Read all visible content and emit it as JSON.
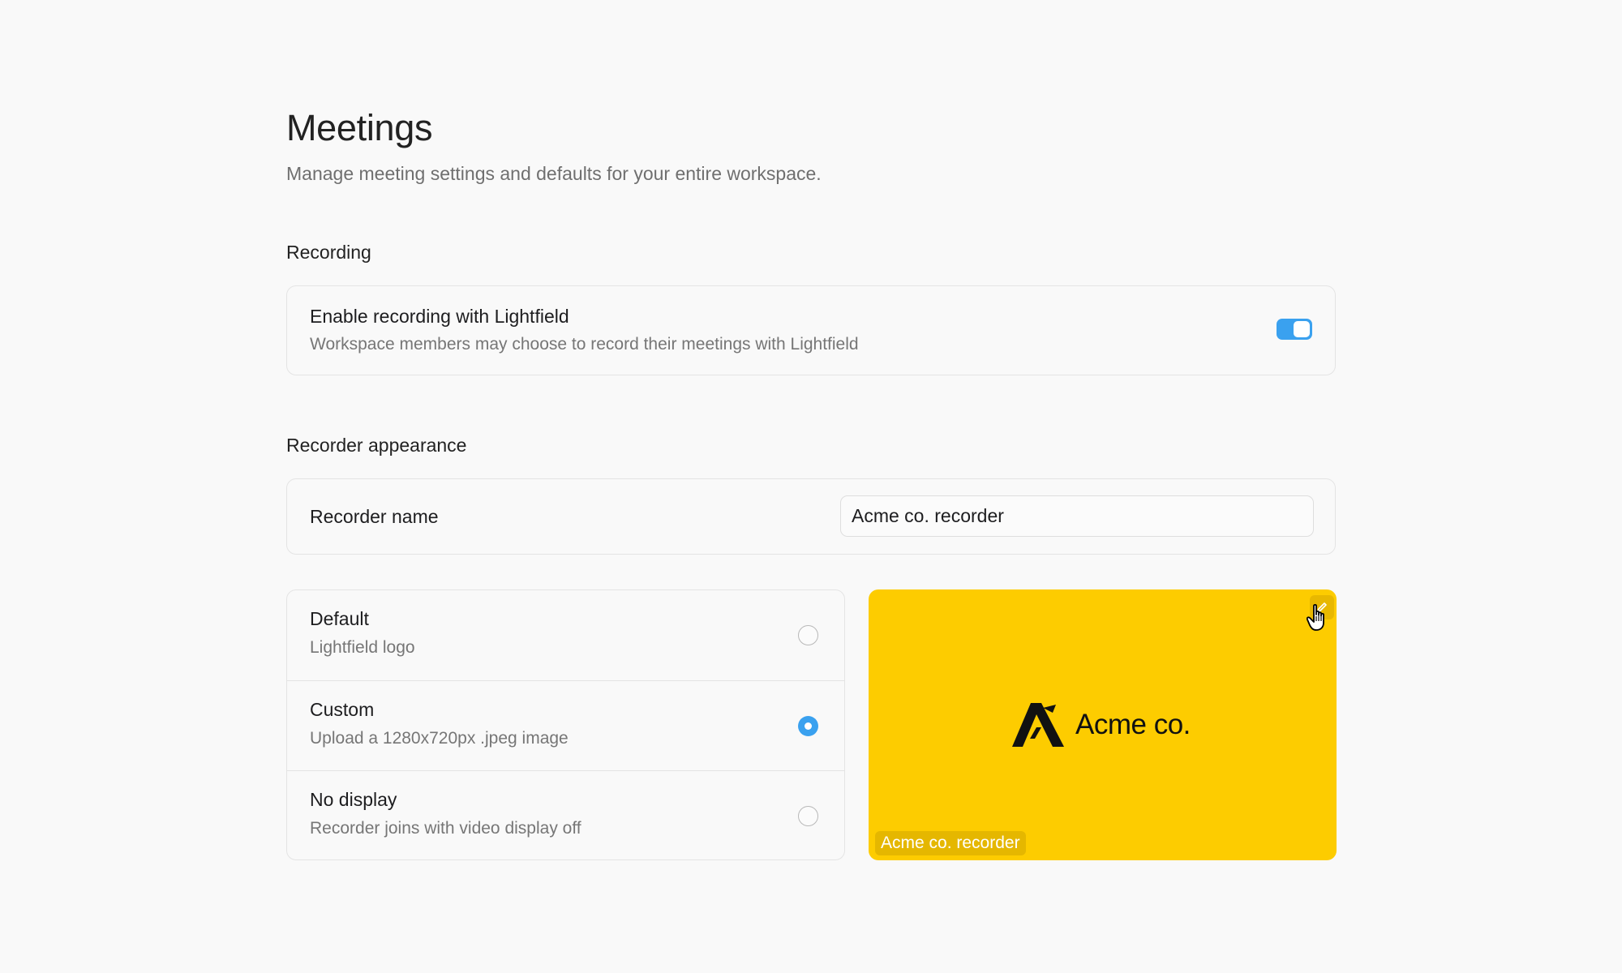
{
  "page": {
    "title": "Meetings",
    "subtitle": "Manage meeting settings and defaults for your entire workspace."
  },
  "recording": {
    "heading": "Recording",
    "enable_title": "Enable recording with Lightfield",
    "enable_desc": "Workspace members may choose to record their meetings with Lightfield",
    "enabled": true
  },
  "appearance": {
    "heading": "Recorder appearance",
    "name_label": "Recorder name",
    "name_value": "Acme co. recorder",
    "options": [
      {
        "title": "Default",
        "desc": "Lightfield logo",
        "selected": false
      },
      {
        "title": "Custom",
        "desc": "Upload a 1280x720px .jpeg image",
        "selected": true
      },
      {
        "title": "No display",
        "desc": "Recorder joins with video display off",
        "selected": false
      }
    ],
    "preview": {
      "brand_name": "Acme co.",
      "label": "Acme co. recorder",
      "background": "#fdcc00"
    }
  },
  "colors": {
    "accent": "#3aa1ef",
    "preview_yellow": "#fdcc00"
  },
  "icons": {
    "edit": "pencil-icon",
    "logo": "acme-logo-icon",
    "cursor": "hand-pointer-icon"
  }
}
